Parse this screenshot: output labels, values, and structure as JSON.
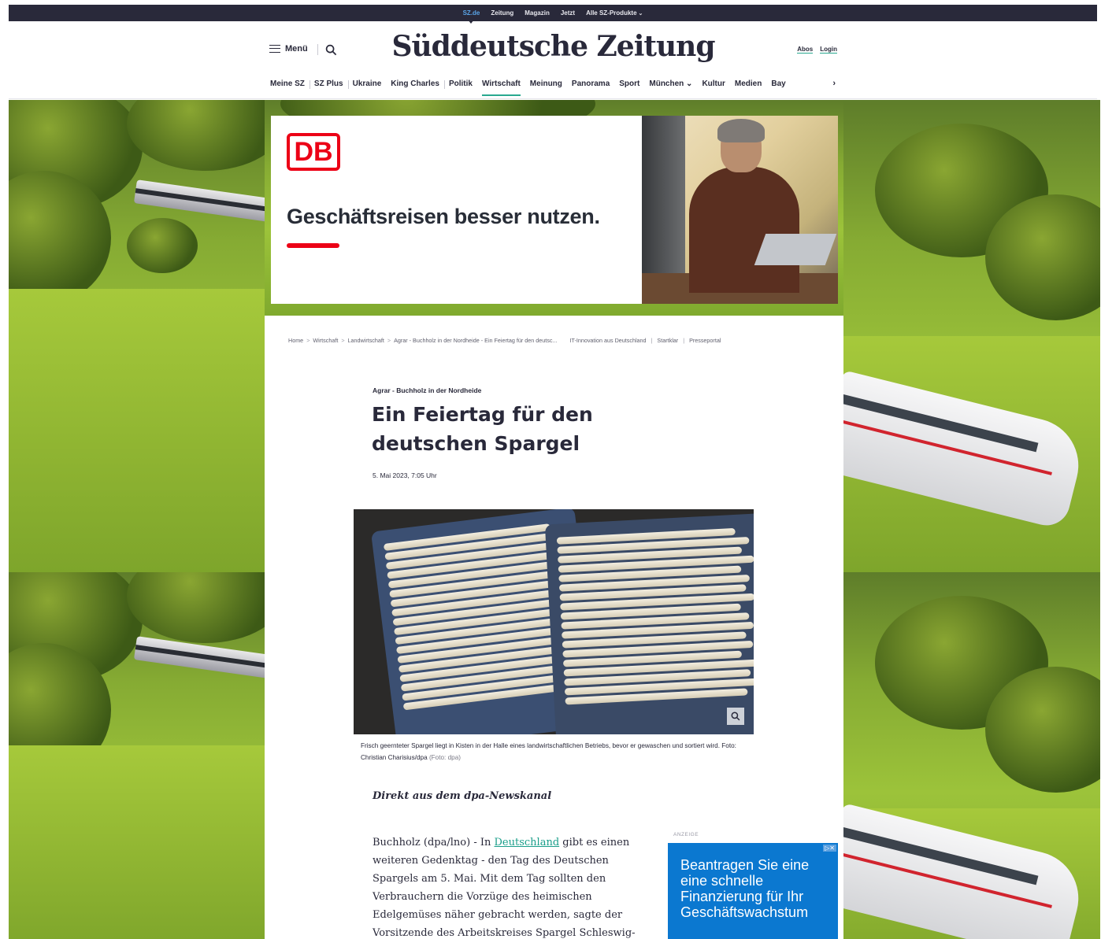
{
  "productbar": {
    "items": [
      "SZ.de",
      "Zeitung",
      "Magazin",
      "Jetzt",
      "Alle SZ-Produkte"
    ]
  },
  "header": {
    "menu_label": "Menü",
    "logo": "Süddeutsche Zeitung",
    "abos": "Abos",
    "login": "Login"
  },
  "nav": {
    "items": [
      "Meine SZ",
      "SZ Plus",
      "Ukraine",
      "King Charles",
      "Politik",
      "Wirtschaft",
      "Meinung",
      "Panorama",
      "Sport",
      "München",
      "Kultur",
      "Medien",
      "Bay"
    ],
    "active": "Wirtschaft"
  },
  "ad_banner": {
    "logo_text": "DB",
    "headline": "Geschäftsreisen besser nutzen.",
    "brand_color": "#ec0016"
  },
  "article": {
    "breadcrumb": [
      "Home",
      "Wirtschaft",
      "Landwirtschaft",
      "Agrar - Buchholz in der Nordheide - Ein Feiertag für den deutsc..."
    ],
    "breadcrumb_right": [
      "IT-Innovation aus Deutschland",
      "Startklar",
      "Presseportal"
    ],
    "kicker": "Agrar - Buchholz in der Nordheide",
    "headline": "Ein Feiertag für den deutschen Spargel",
    "date": "5. Mai 2023, 7:05 Uhr",
    "caption": "Frisch geernteter Spargel liegt in Kisten in der Halle eines landwirtschaftlichen Betriebs, bevor er gewaschen und sortiert wird. Foto: Christian Charisius/dpa",
    "caption_credit": "(Foto: dpa)",
    "newsfeed": "Direkt aus dem dpa-Newskanal",
    "body_prefix": "Buchholz (dpa/lno) - In ",
    "body_link": "Deutschland",
    "body_suffix": " gibt es einen weiteren Gedenktag - den Tag des Deutschen Spargels am 5. Mai. Mit dem Tag sollten den Verbrauchern die Vorzüge des heimischen Edelgemüses näher gebracht werden, sagte der Vorsitzende des Arbeitskreises Spargel Schleswig-"
  },
  "side_ad": {
    "label": "ANZEIGE",
    "text": "Beantragen Sie eine eine schnelle Finanzierung für Ihr Geschäftswachstum",
    "adchoices": "▷✕",
    "color": "#0b78d0"
  },
  "colors": {
    "accent": "#29a88f",
    "dark": "#29293a"
  }
}
